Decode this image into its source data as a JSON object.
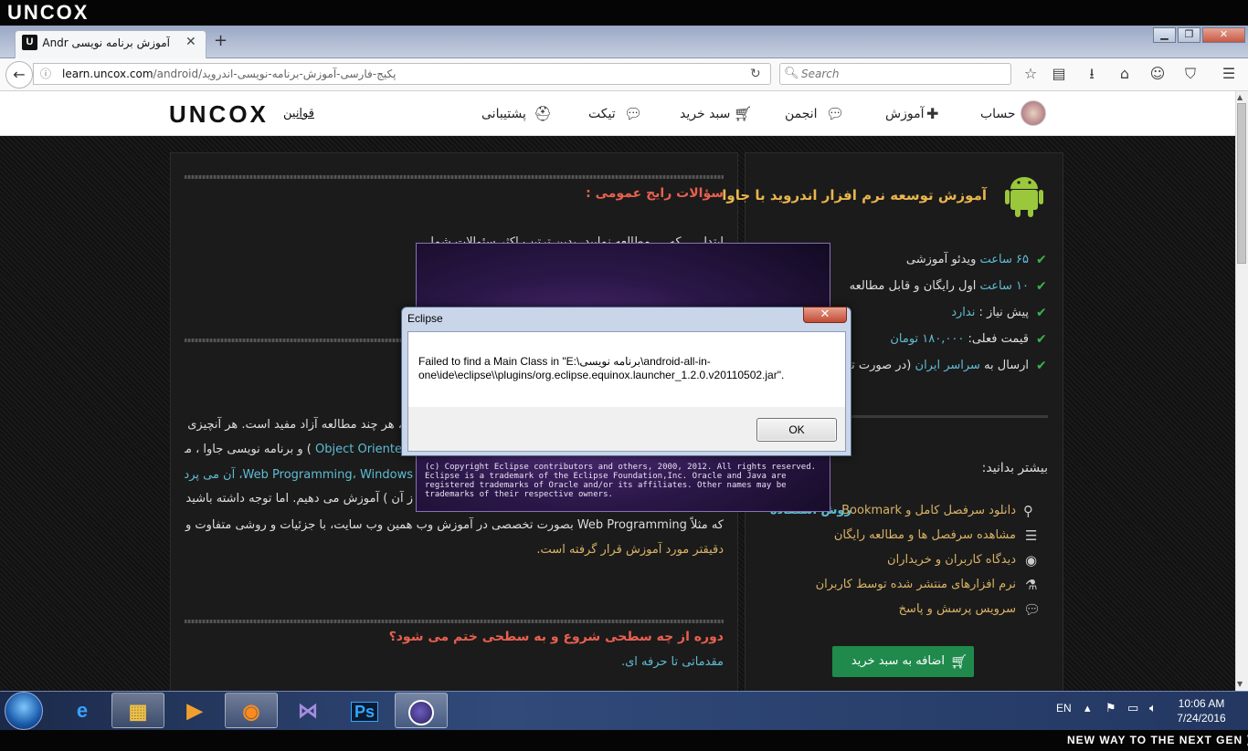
{
  "brand_top": "UNCOX",
  "tagline": "NEW WAY TO THE NEXT GEN ⟩",
  "browser": {
    "tab_title": "آموزش برنامه نویسی Andr...",
    "url_host": "learn.uncox.com",
    "url_path": "/android/پکیج-فارسی-آموزش-برنامه-نویسی-اندروید",
    "search_placeholder": "Search",
    "window_buttons": {
      "minimize": "▁",
      "maximize": "❐",
      "close": "✕"
    }
  },
  "site": {
    "logo": "UNCOX",
    "rules_link": "قوانین",
    "nav": [
      {
        "label": "پشتیبانی",
        "icon": "lifebuoy-icon"
      },
      {
        "label": "تیکت",
        "icon": "chat-icon"
      },
      {
        "label": "سبد خرید",
        "icon": "cart-icon"
      },
      {
        "label": "انجمن",
        "icon": "chat-icon"
      },
      {
        "label": "آموزش",
        "icon": "puzzle-icon"
      },
      {
        "label": "حساب",
        "icon": "avatar-icon"
      }
    ]
  },
  "course": {
    "title": "آموزش توسعه نرم افزار اندروید با جاوا",
    "features": [
      {
        "prefix": "",
        "highlight": "۶۵ ساعت",
        "suffix": " ویدئو آموزشی"
      },
      {
        "prefix": "",
        "highlight": "۱۰ ساعت",
        "suffix": " اول رایگان و قابل مطالعه"
      },
      {
        "prefix": "پیش نیاز : ",
        "highlight": "ندارد",
        "suffix": ""
      },
      {
        "prefix": "قیمت فعلی: ",
        "highlight": "۱۸۰,۰۰۰ تومان",
        "suffix": ""
      },
      {
        "prefix": "ارسال به ",
        "highlight": "سراسر ایران",
        "suffix": " (در صورت تما"
      }
    ],
    "more_heading": "بیشتر بدانید:",
    "more_links": [
      {
        "text": "دانلود سرفصل کامل و Bookmark",
        "extra": "روش استفاده",
        "icon": "search-icon"
      },
      {
        "text": "مشاهده سرفصل ها و مطالعه رایگان",
        "icon": "list-icon"
      },
      {
        "text": "دیدگاه کاربران و خریداران",
        "icon": "rss-icon"
      },
      {
        "text": "نرم افزارهای منتشر شده توسط کاربران",
        "icon": "flask-icon"
      },
      {
        "text": "سرویس پرسش و پاسخ",
        "icon": "chat-icon"
      }
    ],
    "cart_button": "اضافه به سبد خرید"
  },
  "faq": {
    "heading": "سؤالات رایج عمومی :",
    "intro": "ابتدا، ... که ... مطالعه نمایید، بدین ترتیب اکثر سئوالات شما",
    "para": [
      "، هر چند مطالعه آزاد مفید است. هر آنچیزی",
      ") و برنامه نویسی جاوا ، مورد",
      "Web Programming، Windows،   آن می پردازیم",
      "ز آن ) آموزش می دهیم. اما توجه داشته باشید",
      "که مثلاً Web Programming بصورت تخصصی در آموزش وب همین وب سایت، با جزئیات و روشی متفاوت و",
      "دقیقتر مورد آموزش قرار گرفته است."
    ],
    "para_en": "Object Oriente",
    "q2": "دوره از چه سطحی شروع و به سطحی ختم می شود؟",
    "a2": "مقدماتی تا حرفه ای."
  },
  "splash": {
    "copyright": "(c) Copyright Eclipse contributors and others, 2000, 2012.  All rights reserved. Eclipse is a trademark of the Eclipse Foundation,Inc. Oracle and Java are registered trademarks of Oracle and/or its affiliates. Other names may be trademarks of their respective owners."
  },
  "dialog": {
    "title": "Eclipse",
    "message": "Failed to find a Main Class in \"E:\\برنامه نویسی\\android-all-in-one\\ide\\eclipse\\\\plugins/org.eclipse.equinox.launcher_1.2.0.v20110502.jar\".",
    "ok": "OK",
    "close": "✕"
  },
  "taskbar": {
    "apps": [
      "internet-explorer",
      "file-explorer",
      "media-player",
      "firefox",
      "visual-studio",
      "photoshop",
      "eclipse"
    ],
    "ps_label": "Ps",
    "lang": "EN",
    "time": "10:06 AM",
    "date": "7/24/2016"
  }
}
